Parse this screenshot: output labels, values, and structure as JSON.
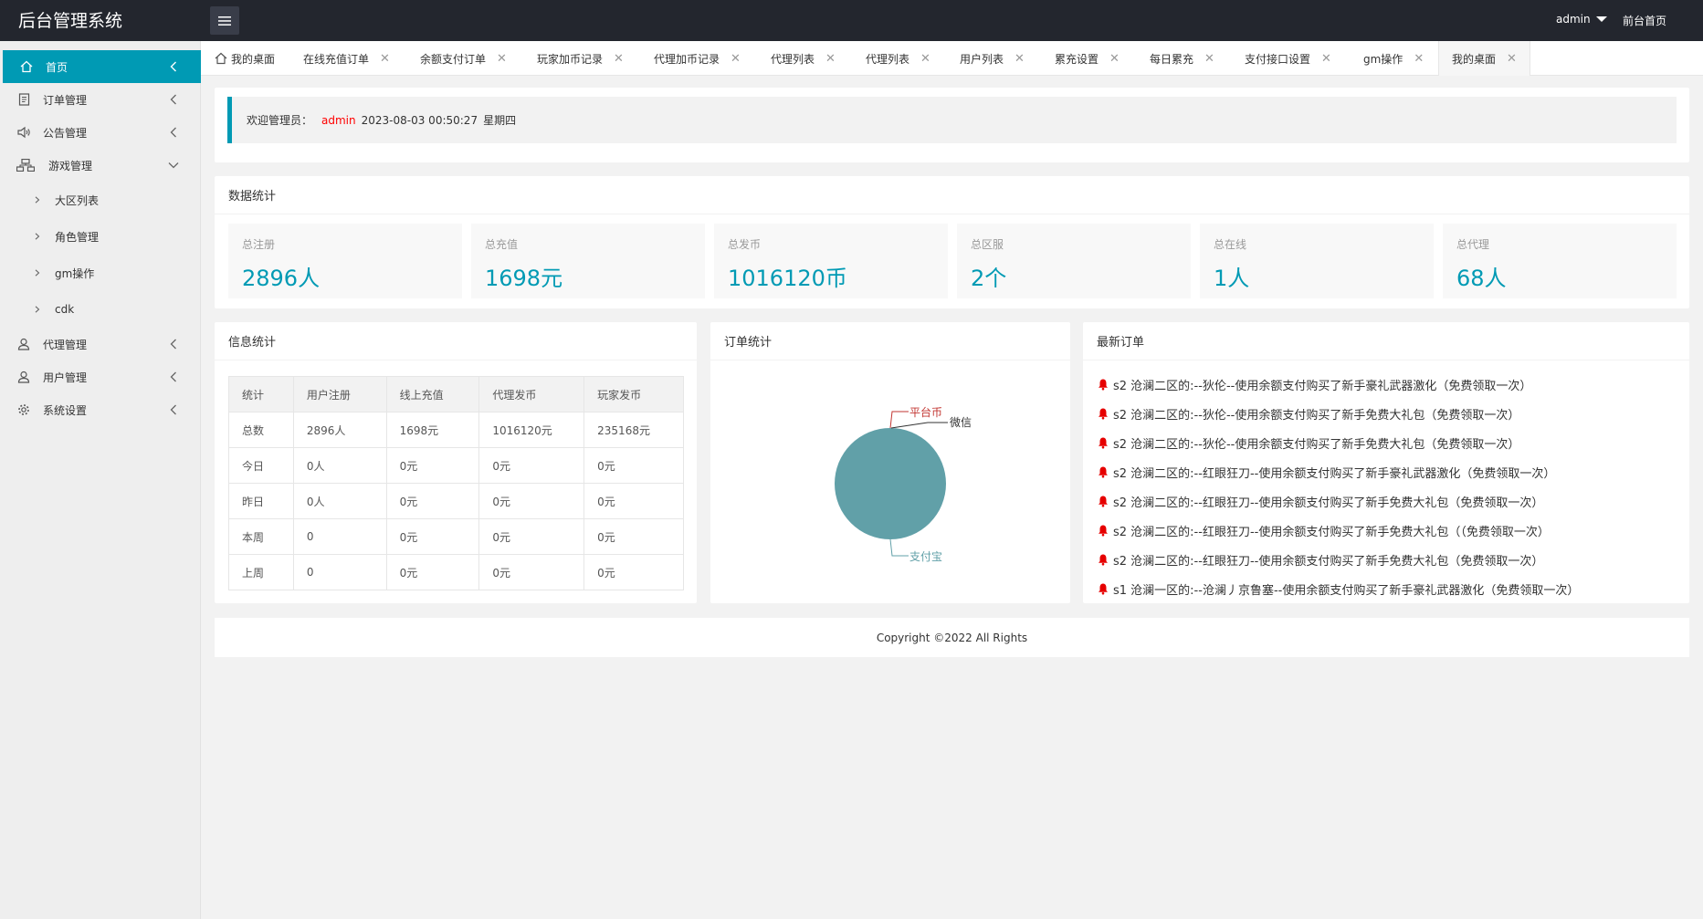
{
  "header": {
    "title": "后台管理系统",
    "user": "admin",
    "front_link": "前台首页"
  },
  "sidebar": {
    "items": [
      {
        "label": "首页",
        "icon": "home-icon"
      },
      {
        "label": "订单管理",
        "icon": "document-icon"
      },
      {
        "label": "公告管理",
        "icon": "speaker-icon"
      },
      {
        "label": "游戏管理",
        "icon": "sitemap-icon"
      },
      {
        "label": "代理管理",
        "icon": "user-icon"
      },
      {
        "label": "用户管理",
        "icon": "user-icon"
      },
      {
        "label": "系统设置",
        "icon": "gear-icon"
      }
    ],
    "sub_items": [
      "大区列表",
      "角色管理",
      "gm操作",
      "cdk"
    ]
  },
  "tabs": [
    {
      "label": "我的桌面"
    },
    {
      "label": "在线充值订单"
    },
    {
      "label": "余额支付订单"
    },
    {
      "label": "玩家加币记录"
    },
    {
      "label": "代理加币记录"
    },
    {
      "label": "代理列表"
    },
    {
      "label": "代理列表"
    },
    {
      "label": "用户列表"
    },
    {
      "label": "累充设置"
    },
    {
      "label": "每日累充"
    },
    {
      "label": "支付接口设置"
    },
    {
      "label": "gm操作"
    },
    {
      "label": "我的桌面"
    }
  ],
  "welcome": {
    "prefix": "欢迎管理员：",
    "user": "admin",
    "datetime": "2023-08-03  00:50:27",
    "weekday": "星期四"
  },
  "stats": {
    "title": "数据统计",
    "boxes": [
      {
        "label": "总注册",
        "value": "2896人"
      },
      {
        "label": "总充值",
        "value": "1698元"
      },
      {
        "label": "总发币",
        "value": "1016120币"
      },
      {
        "label": "总区服",
        "value": "2个"
      },
      {
        "label": "总在线",
        "value": "1人"
      },
      {
        "label": "总代理",
        "value": "68人"
      }
    ]
  },
  "info": {
    "title": "信息统计",
    "headers": [
      "统计",
      "用户注册",
      "线上充值",
      "代理发币",
      "玩家发币"
    ],
    "rows": [
      [
        "总数",
        "2896人",
        "1698元",
        "1016120元",
        "235168元"
      ],
      [
        "今日",
        "0人",
        "0元",
        "0元",
        "0元"
      ],
      [
        "昨日",
        "0人",
        "0元",
        "0元",
        "0元"
      ],
      [
        "本周",
        "0",
        "0元",
        "0元",
        "0元"
      ],
      [
        "上周",
        "0",
        "0元",
        "0元",
        "0元"
      ]
    ]
  },
  "order_chart": {
    "title": "订单统计",
    "pie_color": "#61a0a8",
    "labels": [
      {
        "text": "平台币",
        "color": "#c23531"
      },
      {
        "text": "微信",
        "color": "#333333"
      },
      {
        "text": "支付宝",
        "color": "#61a0a8"
      }
    ]
  },
  "chart_data": {
    "type": "pie",
    "slices": [
      {
        "name": "平台币",
        "value": 0
      },
      {
        "name": "微信",
        "value": 0
      },
      {
        "name": "支付宝",
        "value": 100
      }
    ]
  },
  "latest_orders": {
    "title": "最新订单",
    "items": [
      "s2 沧澜二区的:--狄伦--使用余额支付购买了新手豪礼武器激化（免费领取一次）",
      "s2 沧澜二区的:--狄伦--使用余额支付购买了新手免费大礼包（免费领取一次）",
      "s2 沧澜二区的:--狄伦--使用余额支付购买了新手免费大礼包（免费领取一次）",
      "s2 沧澜二区的:--红眼狂刀--使用余额支付购买了新手豪礼武器激化（免费领取一次）",
      "s2 沧澜二区的:--红眼狂刀--使用余额支付购买了新手免费大礼包（免费领取一次）",
      "s2 沧澜二区的:--红眼狂刀--使用余额支付购买了新手免费大礼包（（免费领取一次）",
      "s2 沧澜二区的:--红眼狂刀--使用余额支付购买了新手免费大礼包（免费领取一次）",
      "s1 沧澜一区的:--沧澜丿京鲁塞--使用余额支付购买了新手豪礼武器激化（免费领取一次）"
    ]
  },
  "footer": "Copyright ©2022 All Rights"
}
